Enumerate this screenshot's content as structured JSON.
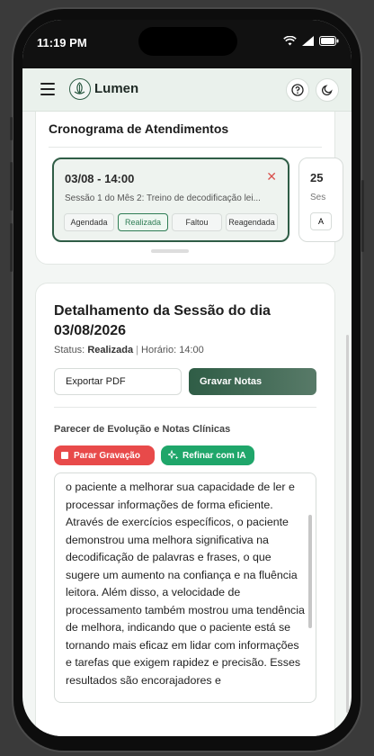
{
  "status_bar": {
    "time": "11:19 PM"
  },
  "app": {
    "name": "Lumen"
  },
  "schedule": {
    "title": "Cronograma de Atendimentos",
    "sessions": [
      {
        "date": "03/08 - 14:00",
        "description": "Sessão 1 do Mês 2: Treino de decodificação lei...",
        "statuses": [
          "Agendada",
          "Realizada",
          "Faltou",
          "Reagendada"
        ],
        "active_status": "Realizada"
      },
      {
        "date": "25",
        "description": "Ses",
        "first_status": "A"
      }
    ]
  },
  "detail": {
    "title": "Detalhamento da Sessão do dia 03/08/2026",
    "status_label": "Status:",
    "status_value": "Realizada",
    "time_text": "Horário: 14:00",
    "export_label": "Exportar PDF",
    "record_label": "Gravar Notas",
    "notes_label": "Parecer de Evolução e Notas Clínicas",
    "stop_label": "Parar Gravação",
    "refine_label": "Refinar com IA",
    "notes_text": "o paciente a melhorar sua capacidade de ler e processar informações de forma eficiente. Através de exercícios específicos, o paciente demonstrou uma melhora significativa na decodificação de palavras e frases, o que sugere um aumento na confiança e na fluência leitora. Além disso, a velocidade de processamento também mostrou uma tendência de melhora, indicando que o paciente está se tornando mais eficaz em lidar com informações e tarefas que exigem rapidez e precisão. Esses resultados são encorajadores e"
  },
  "colors": {
    "primary": "#2f5d46",
    "danger": "#e84a4a",
    "ai": "#1fa66a"
  }
}
